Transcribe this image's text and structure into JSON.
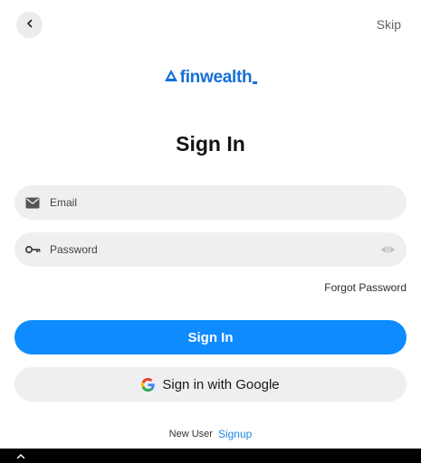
{
  "header": {
    "skip_label": "Skip"
  },
  "brand": {
    "logo_text": "finwealth",
    "color": "#1570d6"
  },
  "page": {
    "title": "Sign In"
  },
  "form": {
    "email_placeholder": "Email",
    "password_placeholder": "Password",
    "forgot_label": "Forgot Password",
    "signin_label": "Sign In",
    "google_label": "Sign in with Google"
  },
  "footer": {
    "new_user_label": "New User",
    "signup_label": "Signup"
  },
  "icons": {
    "back": "chevron-left-icon",
    "email": "mail-icon",
    "password": "key-icon",
    "visibility": "eye-icon",
    "google": "google-icon",
    "nav_up": "chevron-up-icon"
  },
  "colors": {
    "primary": "#0e8bff",
    "field_bg": "#efeff1",
    "link": "#1e88e5"
  }
}
